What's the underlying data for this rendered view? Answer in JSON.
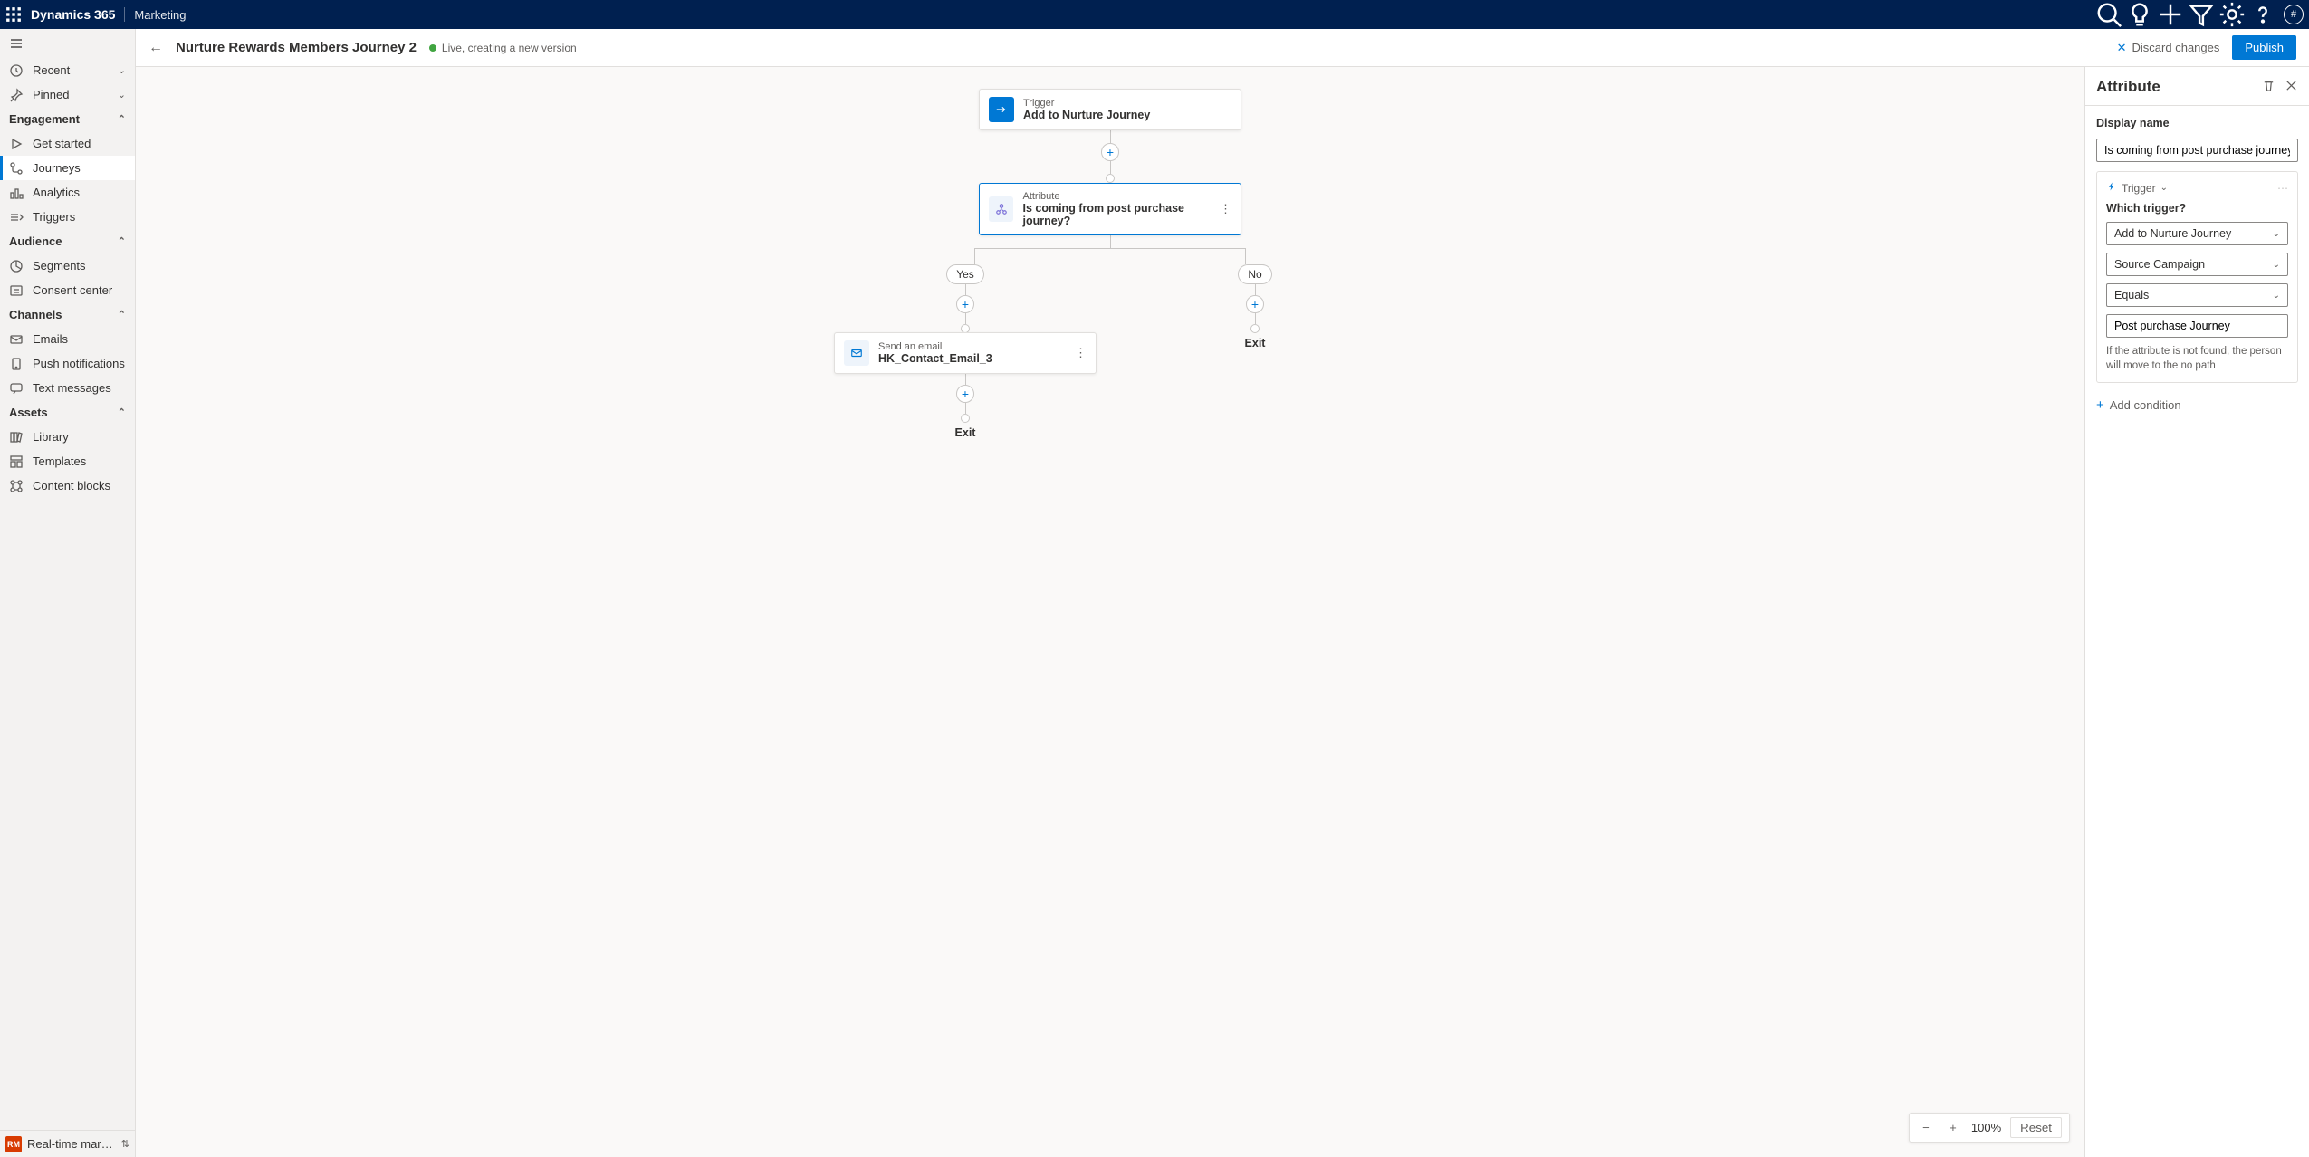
{
  "topbar": {
    "brand": "Dynamics 365",
    "module": "Marketing",
    "avatar": "#"
  },
  "sidebar": {
    "recent": "Recent",
    "pinned": "Pinned",
    "groups": {
      "engagement": {
        "label": "Engagement",
        "items": [
          {
            "label": "Get started",
            "icon": "play"
          },
          {
            "label": "Journeys",
            "icon": "journey",
            "selected": true
          },
          {
            "label": "Analytics",
            "icon": "analytics"
          },
          {
            "label": "Triggers",
            "icon": "trigger"
          }
        ]
      },
      "audience": {
        "label": "Audience",
        "items": [
          {
            "label": "Segments",
            "icon": "segments"
          },
          {
            "label": "Consent center",
            "icon": "consent"
          }
        ]
      },
      "channels": {
        "label": "Channels",
        "items": [
          {
            "label": "Emails",
            "icon": "mail"
          },
          {
            "label": "Push notifications",
            "icon": "push"
          },
          {
            "label": "Text messages",
            "icon": "sms"
          }
        ]
      },
      "assets": {
        "label": "Assets",
        "items": [
          {
            "label": "Library",
            "icon": "library"
          },
          {
            "label": "Templates",
            "icon": "templates"
          },
          {
            "label": "Content blocks",
            "icon": "blocks"
          }
        ]
      }
    },
    "area": {
      "badge": "RM",
      "label": "Real-time marketi..."
    }
  },
  "header": {
    "title": "Nurture Rewards Members Journey 2",
    "status": "Live, creating a new version",
    "discard": "Discard changes",
    "publish": "Publish"
  },
  "journey": {
    "trigger": {
      "type": "Trigger",
      "name": "Add to Nurture Journey"
    },
    "attribute": {
      "type": "Attribute",
      "name": "Is coming from post purchase journey?"
    },
    "branches": {
      "yes": "Yes",
      "no": "No"
    },
    "email": {
      "type": "Send an email",
      "name": "HK_Contact_Email_3"
    },
    "exit": "Exit"
  },
  "zoom": {
    "level": "100%",
    "reset": "Reset"
  },
  "panel": {
    "title": "Attribute",
    "displayName": {
      "label": "Display name",
      "value": "Is coming from post purchase journey?"
    },
    "condition": {
      "badge": "Trigger",
      "whichTrigger": {
        "label": "Which trigger?",
        "value": "Add to Nurture Journey"
      },
      "field": "Source Campaign",
      "operator": "Equals",
      "value": "Post purchase Journey",
      "note": "If the attribute is not found, the person will move to the no path"
    },
    "addCondition": "Add condition"
  }
}
